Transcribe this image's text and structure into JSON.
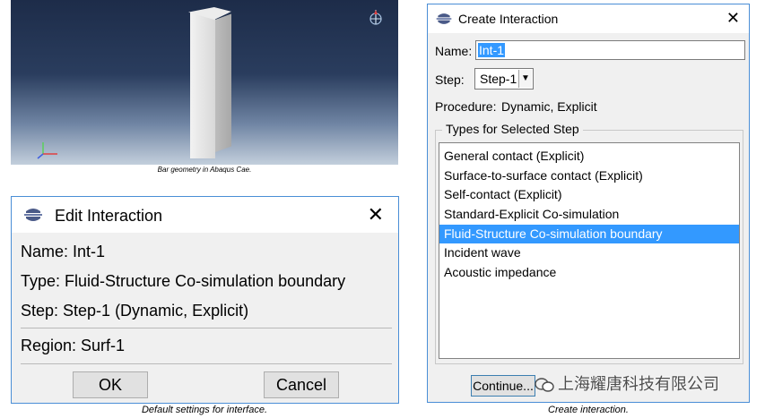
{
  "viewport": {
    "caption": "Bar geometry in Abaqus Cae."
  },
  "edit_dialog": {
    "title": "Edit Interaction",
    "close_icon": "close-icon",
    "name": "Name:  Int-1",
    "type": "Type:  Fluid-Structure Co-simulation boundary",
    "step": "Step:  Step-1 (Dynamic, Explicit)",
    "region": "Region:  Surf-1",
    "ok_label": "OK",
    "cancel_label": "Cancel",
    "caption": "Default settings for interface."
  },
  "create_dialog": {
    "title": "Create Interaction",
    "name_label": "Name:",
    "name_value": "Int-1",
    "step_label": "Step:",
    "step_value": "Step-1",
    "procedure_label": "Procedure:",
    "procedure_value": "Dynamic, Explicit",
    "types_group_label": "Types for Selected Step",
    "types": [
      "General contact (Explicit)",
      "Surface-to-surface contact (Explicit)",
      "Self-contact (Explicit)",
      "Standard-Explicit Co-simulation",
      "Fluid-Structure Co-simulation boundary",
      "Incident wave",
      "Acoustic impedance"
    ],
    "selected_type": "Fluid-Structure Co-simulation boundary",
    "continue_label": "Continue...",
    "caption": "Create interaction."
  },
  "watermark": {
    "text": "上海耀唐科技有限公司"
  },
  "colors": {
    "selection": "#3399ff",
    "dialog_border": "#4a8ed6",
    "dialog_bg": "#f0f0f0"
  }
}
